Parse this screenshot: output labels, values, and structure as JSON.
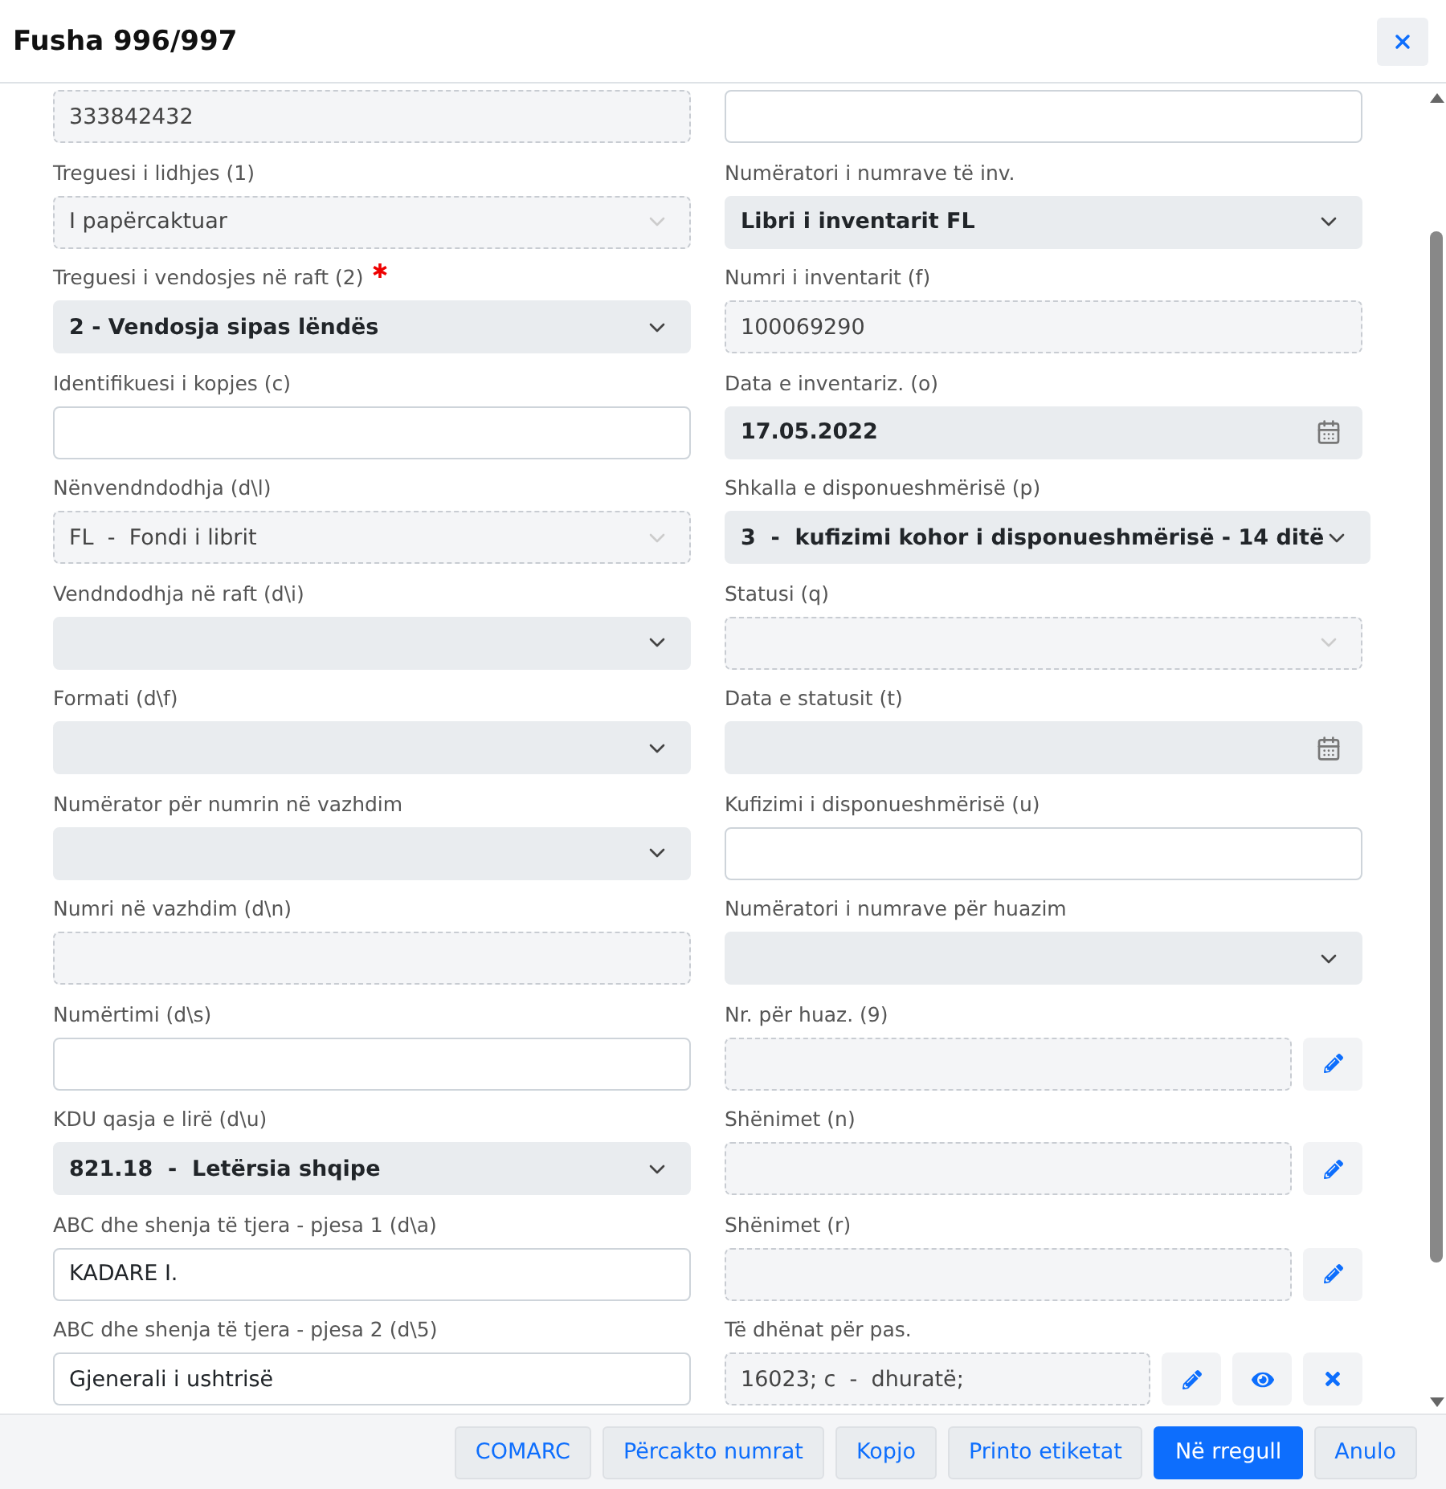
{
  "window": {
    "title": "Fusha 996/997"
  },
  "columns": [
    [
      {
        "kind": "readonly",
        "value": "333842432"
      },
      {
        "kind": "readonly-select",
        "label": "Treguesi i lidhjes (1)",
        "value": "I papërcaktuar"
      },
      {
        "kind": "select",
        "label": "Treguesi i vendosjes në raft (2)",
        "required": true,
        "value": "2 - Vendosja sipas lëndës"
      },
      {
        "kind": "input",
        "label": "Identifikuesi i kopjes (c)"
      },
      {
        "kind": "readonly-select",
        "label": "Nënvendndodhja (d\\l)",
        "value": "FL  -  Fondi i librit"
      },
      {
        "kind": "select",
        "label": "Vendndodhja në raft (d\\i)"
      },
      {
        "kind": "select",
        "label": "Formati (d\\f)"
      },
      {
        "kind": "select",
        "label": "Numërator për numrin në vazhdim"
      },
      {
        "kind": "readonly",
        "label": "Numri në vazhdim (d\\n)"
      },
      {
        "kind": "input",
        "label": "Numërtimi (d\\s)"
      },
      {
        "kind": "select",
        "label": "KDU qasja e lirë (d\\u)",
        "value": "821.18  -  Letërsia shqipe"
      },
      {
        "kind": "input",
        "label": "ABC dhe shenja të tjera - pjesa 1 (d\\a)",
        "value": "KADARE I."
      },
      {
        "kind": "input",
        "label": "ABC dhe shenja të tjera - pjesa 2 (d\\5)",
        "value": "Gjenerali i ushtrisë"
      }
    ],
    [
      {
        "kind": "input"
      },
      {
        "kind": "select",
        "label": "Numëratori i numrave të inv.",
        "value": "Libri i inventarit FL"
      },
      {
        "kind": "readonly",
        "label": "Numri i inventarit (f)",
        "value": "100069290"
      },
      {
        "kind": "date",
        "label": "Data e inventariz. (o)",
        "value": "17.05.2022"
      },
      {
        "kind": "select",
        "label": "Shkalla e disponueshmërisë (p)",
        "value": "3  -  kufizimi kohor i disponueshmërisë - 14 ditë"
      },
      {
        "kind": "readonly-select",
        "label": "Statusi (q)"
      },
      {
        "kind": "date",
        "label": "Data e statusit (t)"
      },
      {
        "kind": "input",
        "label": "Kufizimi i disponueshmërisë (u)"
      },
      {
        "kind": "select",
        "label": "Numëratori i numrave për huazim"
      },
      {
        "kind": "readonly",
        "label": "Nr. për huaz. (9)",
        "actions": [
          {
            "kind": "edit"
          }
        ]
      },
      {
        "kind": "readonly",
        "label": "Shënimet (n)",
        "actions": [
          {
            "kind": "edit"
          }
        ]
      },
      {
        "kind": "readonly",
        "label": "Shënimet (r)",
        "actions": [
          {
            "kind": "edit"
          }
        ]
      },
      {
        "kind": "readonly",
        "label": "Të dhënat për pas.",
        "value": "16023; c  -  dhuratë;",
        "actions": [
          {
            "kind": "edit"
          },
          {
            "kind": "view"
          },
          {
            "kind": "remove"
          }
        ]
      }
    ]
  ],
  "buttons": [
    {
      "label": "COMARC",
      "primary": false
    },
    {
      "label": "Përcakto numrat",
      "primary": false
    },
    {
      "label": "Kopjo",
      "primary": false
    },
    {
      "label": "Printo etiketat",
      "primary": false
    },
    {
      "label": "Në rregull",
      "primary": true
    },
    {
      "label": "Anulo",
      "primary": false
    }
  ]
}
